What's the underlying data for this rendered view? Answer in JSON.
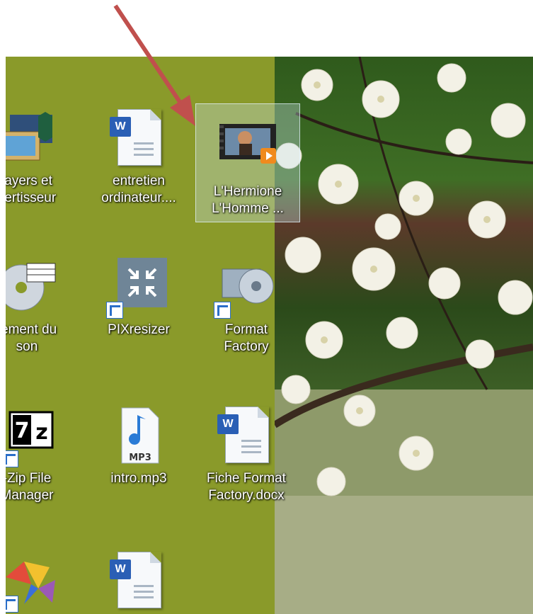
{
  "desktop": {
    "icons": [
      {
        "id": "players",
        "label": "layers et\nvertisseur",
        "col": 0,
        "row": 0,
        "icon": "media-players-icon",
        "shortcut": false
      },
      {
        "id": "entretien",
        "label": "entretien\nordinateur....",
        "col": 1,
        "row": 0,
        "icon": "word-document-icon",
        "shortcut": false
      },
      {
        "id": "hermione",
        "label": "L'Hermione\nL'Homme ...",
        "col": 2,
        "row": 0,
        "icon": "video-file-icon",
        "shortcut": false,
        "selected": true
      },
      {
        "id": "traitement",
        "label": "tement du\nson",
        "col": 0,
        "row": 1,
        "icon": "cd-music-icon",
        "shortcut": true
      },
      {
        "id": "pixresizer",
        "label": "PIXresizer",
        "col": 1,
        "row": 1,
        "icon": "pixresizer-icon",
        "shortcut": true
      },
      {
        "id": "formatfactory",
        "label": "Format\nFactory",
        "col": 2,
        "row": 1,
        "icon": "format-factory-icon",
        "shortcut": true
      },
      {
        "id": "7zip",
        "label": "-Zip File\nManager",
        "col": 0,
        "row": 2,
        "icon": "seven-zip-icon",
        "shortcut": true
      },
      {
        "id": "intro",
        "label": "intro.mp3",
        "col": 1,
        "row": 2,
        "icon": "mp3-file-icon",
        "shortcut": false
      },
      {
        "id": "fiche",
        "label": "Fiche Format\nFactory.docx",
        "col": 2,
        "row": 2,
        "icon": "word-document-icon",
        "shortcut": false
      },
      {
        "id": "colorful",
        "label": "",
        "col": 0,
        "row": 3,
        "icon": "colorful-app-icon",
        "shortcut": true
      },
      {
        "id": "doc4",
        "label": "",
        "col": 1,
        "row": 3,
        "icon": "word-document-icon",
        "shortcut": false
      }
    ],
    "mp3_badge_text": "MP3",
    "zip_badge_text": "7z",
    "word_badge_text": "W"
  },
  "colors": {
    "desktop_green": "#8a9a2a",
    "arrow": "#c0504d"
  }
}
